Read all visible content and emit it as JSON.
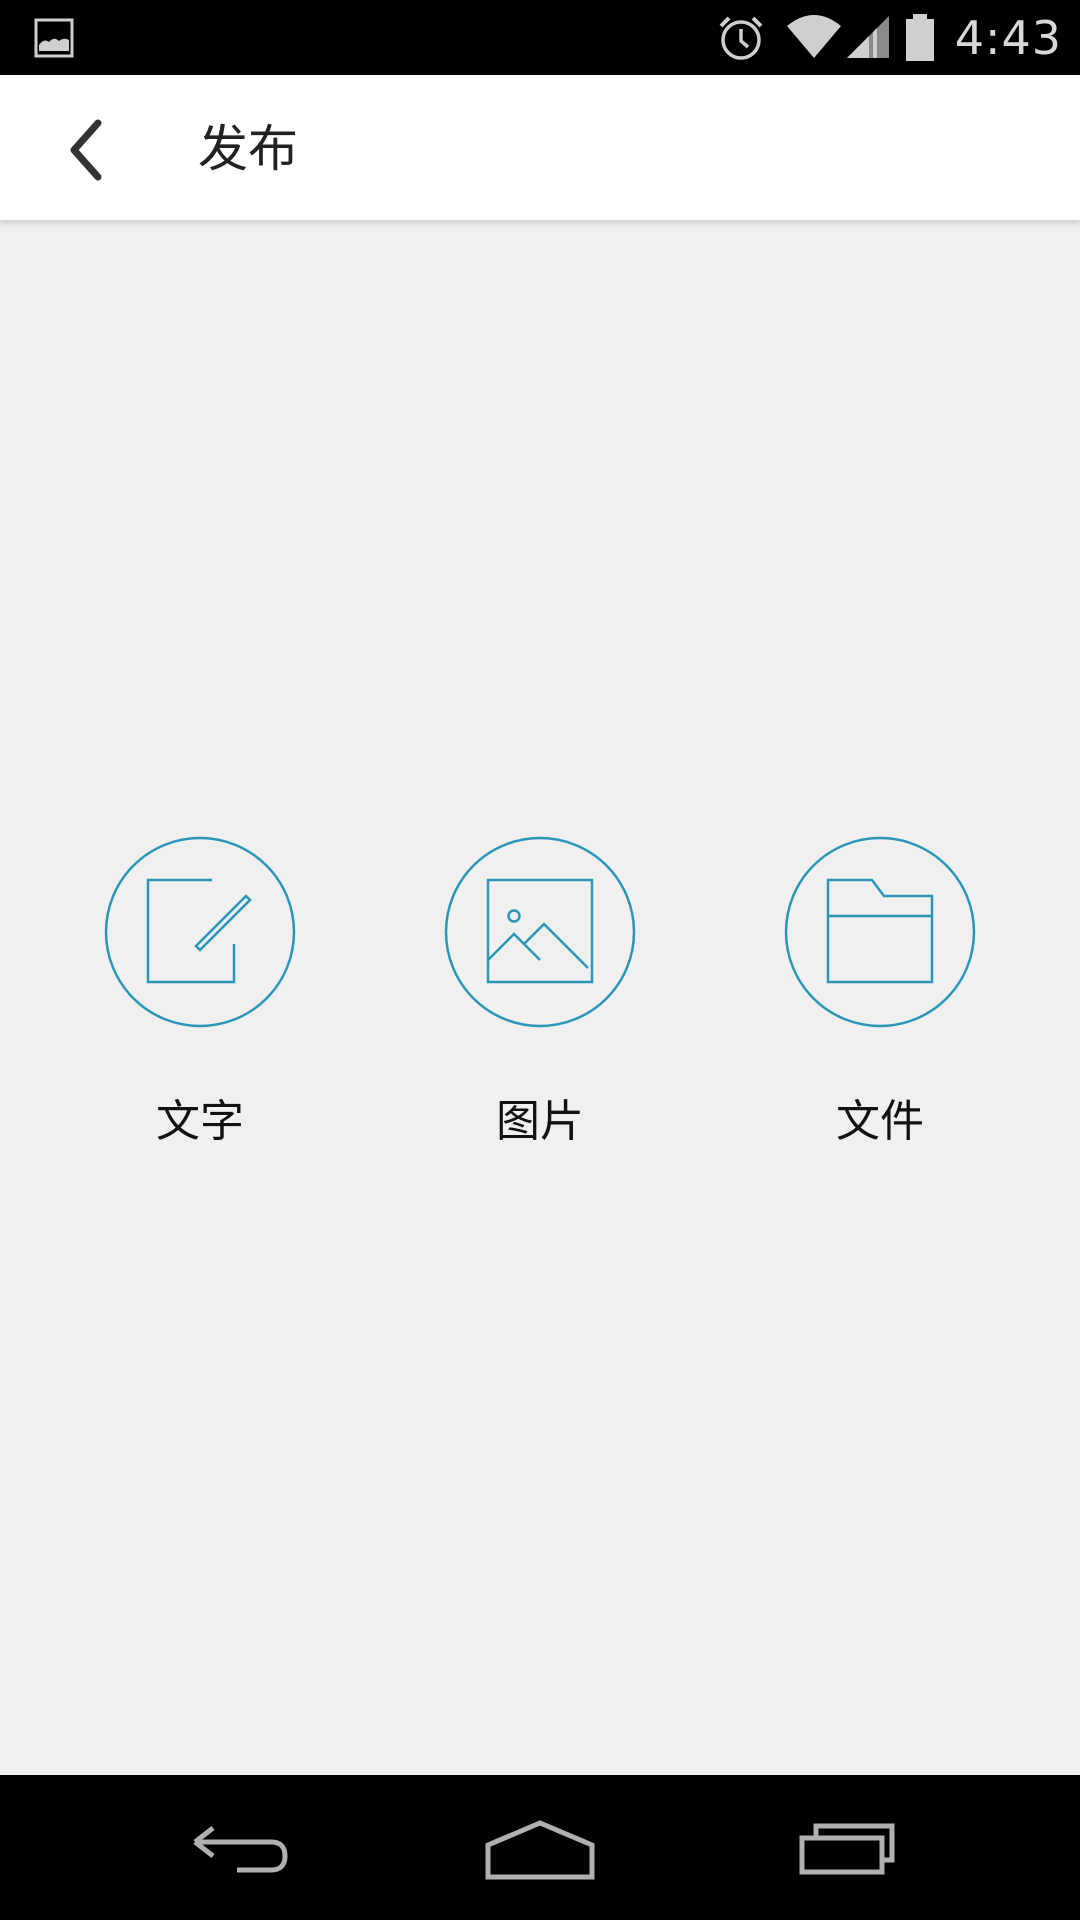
{
  "status_bar": {
    "time": "4:43",
    "icons": [
      "image-notification-icon",
      "alarm-icon",
      "wifi-icon",
      "cellular-signal-icon",
      "battery-icon"
    ]
  },
  "app_bar": {
    "title": "发布",
    "back_icon": "chevron-left-icon"
  },
  "actions": [
    {
      "label": "文字",
      "icon": "edit-icon"
    },
    {
      "label": "图片",
      "icon": "image-icon"
    },
    {
      "label": "文件",
      "icon": "folder-icon"
    }
  ],
  "nav_bar": {
    "icons": [
      "back-nav-icon",
      "home-nav-icon",
      "recents-nav-icon"
    ]
  },
  "colors": {
    "accent": "#2a97b8",
    "background": "#f0f0f0",
    "app_bar": "#ffffff",
    "system_bars": "#000000"
  }
}
